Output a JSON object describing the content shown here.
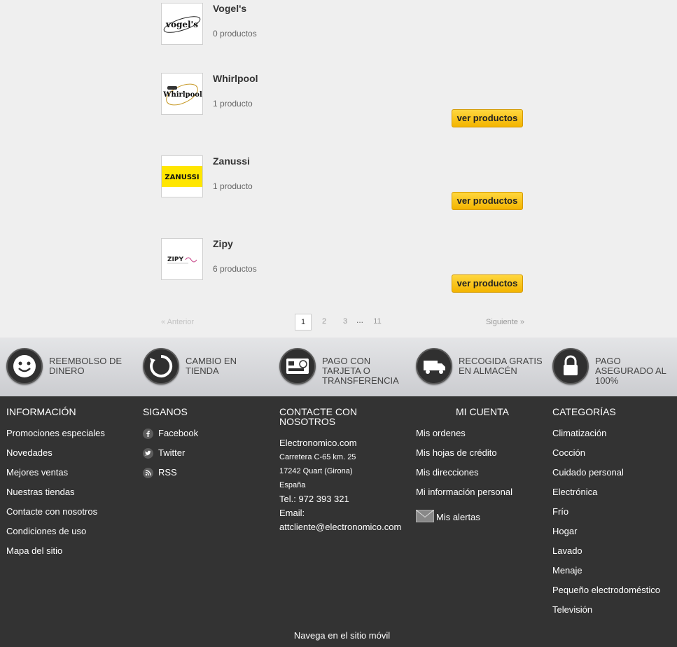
{
  "brands": [
    {
      "name": "Vogel's",
      "count": "0 productos",
      "logo_text": "vogel's",
      "button": ""
    },
    {
      "name": "Whirlpool",
      "count": "1 producto",
      "logo_text": "Whirlpool",
      "button": "ver productos"
    },
    {
      "name": "Zanussi",
      "count": "1 producto",
      "logo_text": "ZANUSSI",
      "button": "ver productos"
    },
    {
      "name": "Zipy",
      "count": "6 productos",
      "logo_text": "ZIPY",
      "button": "ver productos"
    }
  ],
  "pagination": {
    "prev": "« Anterior",
    "pages": [
      "1",
      "2",
      "3"
    ],
    "ellipsis": "...",
    "last": "11",
    "next": "Siguiente »",
    "current": "1"
  },
  "benefits": [
    {
      "icon": "smiley-icon",
      "text": "REEMBOLSO DE DINERO"
    },
    {
      "icon": "refresh-icon",
      "text": "CAMBIO EN TIENDA"
    },
    {
      "icon": "card-icon",
      "text": "PAGO CON TARJETA O TRANSFERENCIA"
    },
    {
      "icon": "truck-icon",
      "text": "RECOGIDA GRATIS EN ALMACÉN"
    },
    {
      "icon": "lock-icon",
      "text": "PAGO ASEGURADO AL 100%"
    }
  ],
  "footer": {
    "info": {
      "title": "INFORMACIÓN",
      "items": [
        "Promociones especiales",
        "Novedades",
        "Mejores ventas",
        "Nuestras tiendas",
        "Contacte con nosotros",
        "Condiciones de uso",
        "Mapa del sitio"
      ]
    },
    "social": {
      "title": "SIGANOS",
      "items": [
        {
          "label": "Facebook",
          "icon": "facebook-icon"
        },
        {
          "label": "Twitter",
          "icon": "twitter-icon"
        },
        {
          "label": "RSS",
          "icon": "rss-icon"
        }
      ]
    },
    "contact": {
      "title": "CONTACTE CON NOSOTROS",
      "company": "Electronomico.com",
      "address1": "Carretera C-65 km. 25",
      "address2": "17242 Quart (Girona)",
      "country": "España",
      "phone": "Tel.: 972 393 321",
      "email_label": "Email:",
      "email": "attcliente@electronomico.com"
    },
    "account": {
      "title": "MI CUENTA",
      "items": [
        "Mis ordenes",
        "Mis hojas de crédito",
        "Mis direcciones",
        "Mi información personal"
      ],
      "alerts": "Mis alertas"
    },
    "categories": {
      "title": "CATEGORÍAS",
      "items": [
        "Climatización",
        "Cocción",
        "Cuidado personal",
        "Electrónica",
        "Frío",
        "Hogar",
        "Lavado",
        "Menaje",
        "Pequeño electrodoméstico",
        "Televisión"
      ]
    },
    "mobile": "Navega en el sitio móvil"
  },
  "colors": {
    "button": "#f6bc0c",
    "footer_bg": "#333333",
    "page_bg": "#efefef"
  }
}
